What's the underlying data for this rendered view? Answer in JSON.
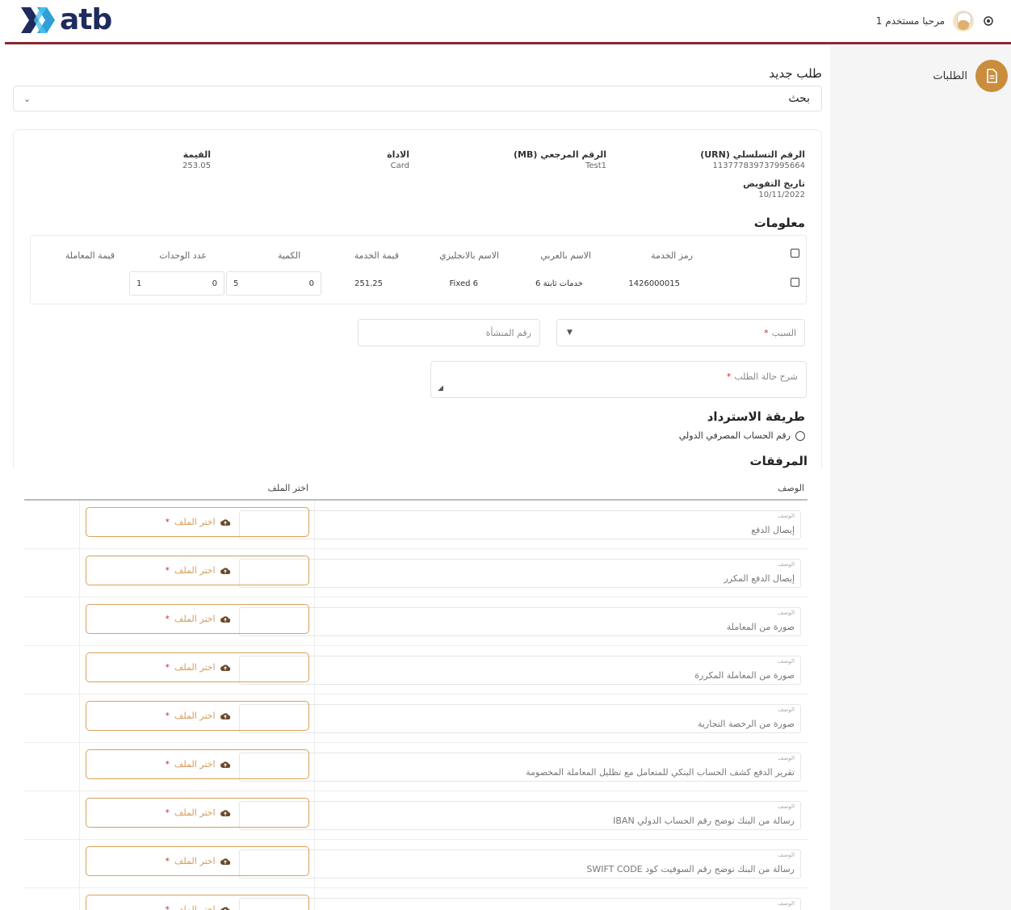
{
  "header": {
    "logo_text": "atb",
    "user_greeting": "مرحبا مستخدم 1",
    "brand_color": "#8b2635"
  },
  "sidebar": {
    "items": [
      {
        "label": "الطلبات",
        "icon": "document-icon"
      }
    ]
  },
  "page": {
    "title": "طلب جديد",
    "search_value": "بحث"
  },
  "details": {
    "urn_label": "الرقم التسلسلي (URN)",
    "urn_value": "113777839737995664",
    "ref_label": "الرقم المرجعي (MB)",
    "ref_value": "Test1",
    "method_label": "الاداة",
    "method_value": "Card",
    "amount_label": "القيمة",
    "amount_value": "253.05",
    "auth_date_label": "تاريخ التفويض",
    "auth_date_value": "10/11/2022"
  },
  "info_section": {
    "title": "معلومات",
    "columns": [
      "رمز الخدمة",
      "الاسم بالعربي",
      "الاسم بالانجليزي",
      "قيمة الخدمة",
      "الكمية",
      "عدد الوحدات",
      "قيمة المعاملة"
    ],
    "rows": [
      {
        "code": "1426000015",
        "name_ar": "خدمات ثابتة 6",
        "name_en": "Fixed 6",
        "price": "251.25",
        "qty_value": "0",
        "qty_cursor": "5",
        "units_value": "0",
        "units_cursor": "1"
      }
    ]
  },
  "form": {
    "reason_label": "السبب",
    "dispute_number_placeholder": "رقم المنشأة",
    "description_label": "شرح حالة الطلب"
  },
  "refund": {
    "title": "طريقة الاسترداد",
    "option": "رقم الحساب المصرفي الدولي"
  },
  "attachments": {
    "title": "المرفقات",
    "col_description": "الوصف",
    "col_file": "اختر الملف",
    "field_mini_label": "الوصف",
    "button_label": "اختر الملف",
    "items": [
      "إيصال الدفع",
      "إيصال الدفع المكرر",
      "صورة من المعاملة",
      "صورة من المعاملة المكررة",
      "صورة من الرخصة التجارية",
      "تقرير الدفع كشف الحساب البنكي للمتعامل  مع تظليل المعاملة المخصومة",
      "رسالة من البنك توضح رقم الحساب الدولي IBAN",
      "رسالة من البنك توضح رقم السوفيت كود  SWIFT CODE",
      ""
    ]
  }
}
